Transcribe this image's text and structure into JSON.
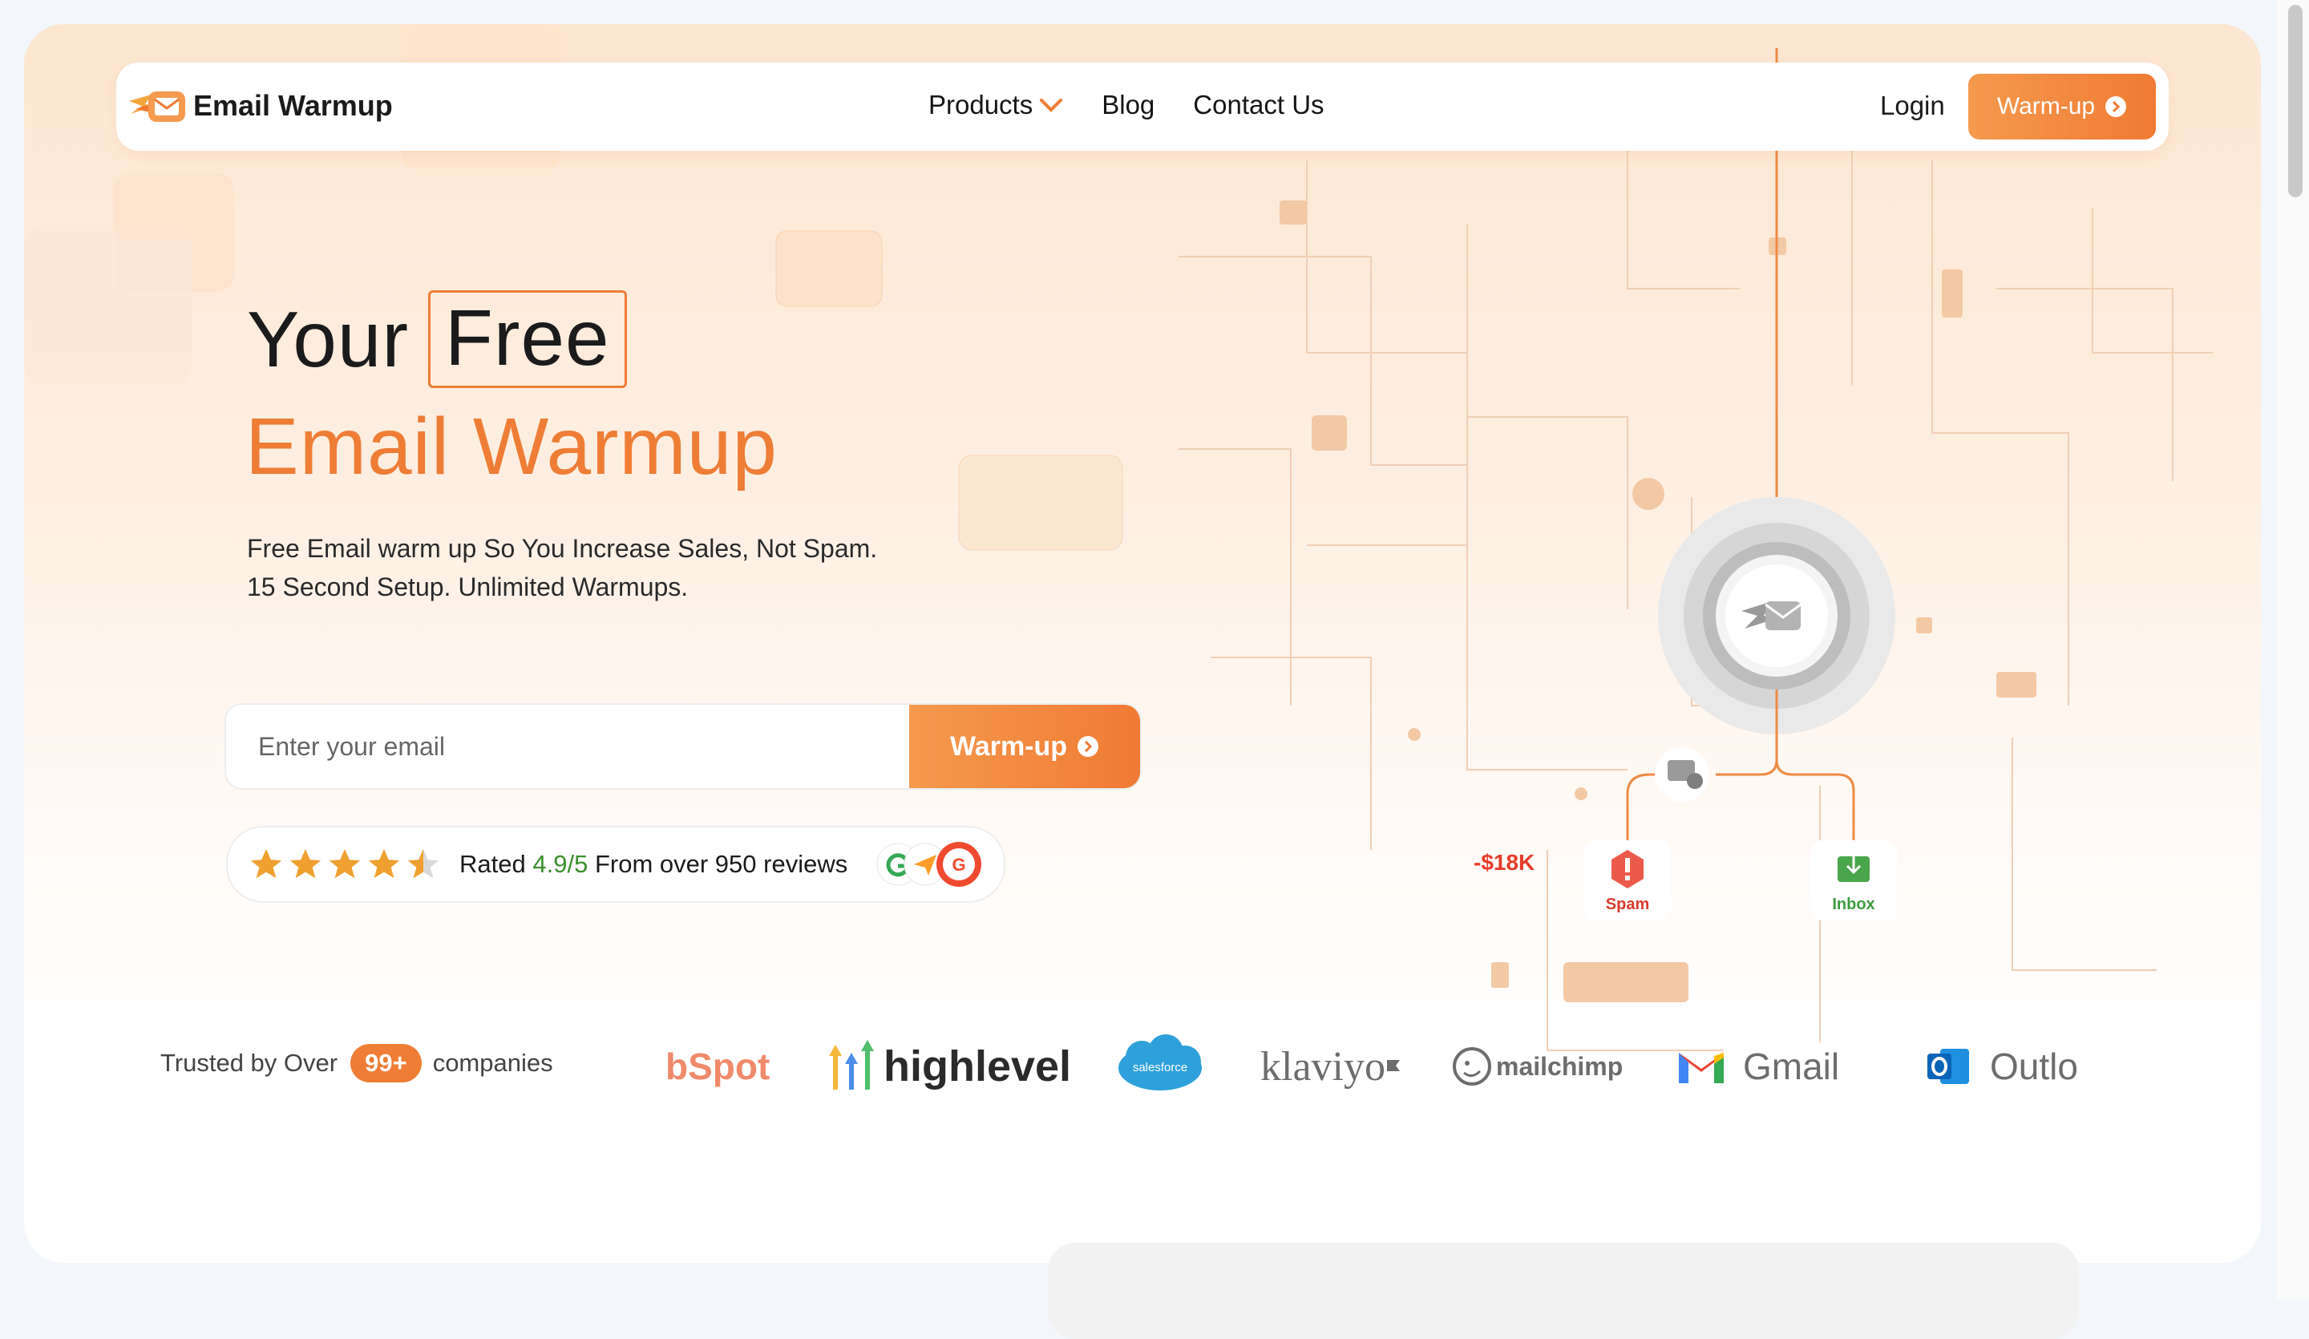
{
  "brand": {
    "name": "Email Warmup",
    "logo_icon": "flaming-envelope-icon",
    "accent": "#ef7d35"
  },
  "nav": {
    "links": [
      {
        "label": "Products",
        "has_dropdown": true
      },
      {
        "label": "Blog"
      },
      {
        "label": "Contact Us"
      }
    ],
    "login_label": "Login",
    "cta_label": "Warm-up"
  },
  "hero": {
    "title_prefix": "Your",
    "title_highlight": "Free",
    "title_line2": "Email Warmup",
    "subtitle_line1": "Free Email warm up So You Increase Sales, Not Spam.",
    "subtitle_line2": "15 Second Setup. Unlimited Warmups."
  },
  "form": {
    "email_placeholder": "Enter your email",
    "email_value": "",
    "button_label": "Warm-up"
  },
  "rating": {
    "stars": 4.5,
    "prefix": "Rated",
    "score": "4.9/5",
    "suffix": "From over 950 reviews",
    "badges": [
      "google-icon",
      "capterra-icon",
      "g2-icon"
    ]
  },
  "trusted": {
    "prefix": "Trusted  by Over",
    "count": "99+",
    "suffix": "companies"
  },
  "logos": [
    "HubSpot",
    "highlevel",
    "salesforce",
    "klaviyo",
    "mailchimp",
    "Gmail",
    "Outlook"
  ],
  "logos_visible_text": {
    "hubspot": "bSpot",
    "highlevel": "highlevel",
    "salesforce": "salesforce",
    "klaviyo": "klaviyo",
    "mailchimp": "mailchimp",
    "gmail": "Gmail",
    "outlook": "Outlo"
  },
  "diagram": {
    "spam_label": "Spam",
    "inbox_label": "Inbox",
    "loss_label": "-$18K"
  },
  "colors": {
    "accent": "#ef7d35",
    "spam": "#d83a2b",
    "inbox": "#3c9b3c"
  }
}
